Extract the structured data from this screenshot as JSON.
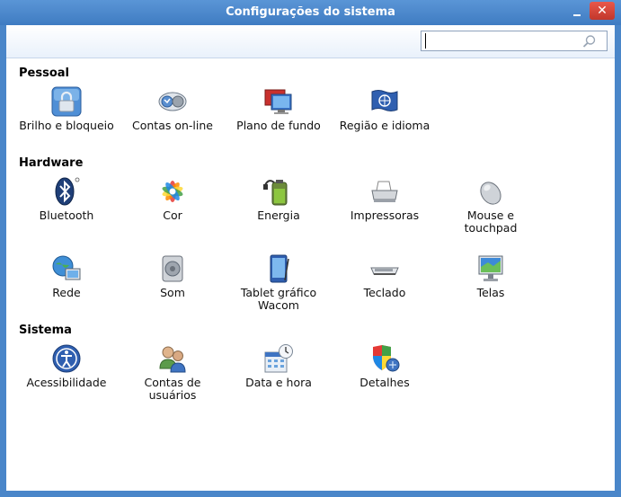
{
  "window": {
    "title": "Configurações do sistema",
    "close_glyph": "✕"
  },
  "search": {
    "value": "",
    "placeholder": ""
  },
  "sections": {
    "pessoal": {
      "title": "Pessoal",
      "items": [
        {
          "label": "Brilho e bloqueio",
          "icon": "lock-icon"
        },
        {
          "label": "Contas on-line",
          "icon": "online-accounts-icon"
        },
        {
          "label": "Plano de fundo",
          "icon": "background-icon"
        },
        {
          "label": "Região e idioma",
          "icon": "region-flag-icon"
        }
      ]
    },
    "hardware": {
      "title": "Hardware",
      "items": [
        {
          "label": "Bluetooth",
          "icon": "bluetooth-icon"
        },
        {
          "label": "Cor",
          "icon": "color-icon"
        },
        {
          "label": "Energia",
          "icon": "battery-icon"
        },
        {
          "label": "Impressoras",
          "icon": "printer-icon"
        },
        {
          "label": "Mouse e touchpad",
          "icon": "mouse-icon"
        },
        {
          "label": "Rede",
          "icon": "network-icon"
        },
        {
          "label": "Som",
          "icon": "speaker-icon"
        },
        {
          "label": "Tablet gráfico Wacom",
          "icon": "tablet-icon"
        },
        {
          "label": "Teclado",
          "icon": "keyboard-icon"
        },
        {
          "label": "Telas",
          "icon": "display-icon"
        }
      ]
    },
    "sistema": {
      "title": "Sistema",
      "items": [
        {
          "label": "Acessibilidade",
          "icon": "accessibility-icon"
        },
        {
          "label": "Contas de usuários",
          "icon": "users-icon"
        },
        {
          "label": "Data e hora",
          "icon": "calendar-clock-icon"
        },
        {
          "label": "Detalhes",
          "icon": "details-shield-icon"
        }
      ]
    }
  }
}
